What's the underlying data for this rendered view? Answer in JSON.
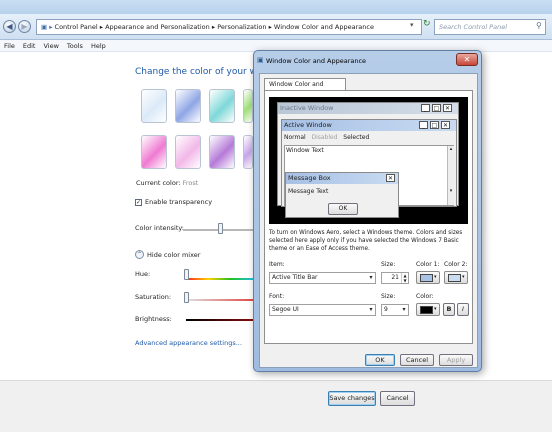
{
  "nav": {
    "breadcrumb": [
      "Control Panel",
      "Appearance and Personalization",
      "Personalization",
      "Window Color and Appearance"
    ],
    "search_placeholder": "Search Control Panel"
  },
  "menu": [
    "File",
    "Edit",
    "View",
    "Tools",
    "Help"
  ],
  "page": {
    "heading": "Change the color of your window be",
    "current_color_label": "Current color:",
    "current_color_value": "Frost",
    "transparency_label": "Enable transparency",
    "transparency_checked": true,
    "intensity_label": "Color intensity:",
    "mixer_toggle": "Hide color mixer",
    "hue_label": "Hue:",
    "saturation_label": "Saturation:",
    "brightness_label": "Brightness:",
    "advanced_link": "Advanced appearance settings...",
    "swatch_colors_row1": [
      "#dbe9f8",
      "#8fa6e6",
      "#7fd8d8",
      "#9fe07a"
    ],
    "swatch_colors_row2": [
      "#f07ad2",
      "#f2b8e8",
      "#b57ad8",
      "#c7a6ea"
    ]
  },
  "footer": {
    "save": "Save changes",
    "cancel": "Cancel"
  },
  "dialog": {
    "title": "Window Color and Appearance",
    "tab": "Window Color and Appearance",
    "preview": {
      "inactive_title": "Inactive Window",
      "active_title": "Active Window",
      "menu_normal": "Normal",
      "menu_disabled": "Disabled",
      "menu_selected": "Selected",
      "window_text": "Window Text",
      "msgbox_title": "Message Box",
      "msgbox_text": "Message Text",
      "ok": "OK"
    },
    "info": "To turn on Windows Aero, select a Windows theme.  Colors and sizes selected here apply only if you have selected the Windows 7 Basic theme or an Ease of Access theme.",
    "item_label": "Item:",
    "item_value": "Active Title Bar",
    "size_label": "Size:",
    "size_value": "21",
    "color1_label": "Color 1:",
    "color2_label": "Color 2:",
    "font_label": "Font:",
    "font_value": "Segoe UI",
    "font_size_label": "Size:",
    "font_size_value": "9",
    "font_color_label": "Color:",
    "bold": "B",
    "italic": "I",
    "ok": "OK",
    "cancel": "Cancel",
    "apply": "Apply",
    "color1": "#a9c3e6",
    "color2": "#c9dcf2",
    "font_color": "#000000"
  }
}
